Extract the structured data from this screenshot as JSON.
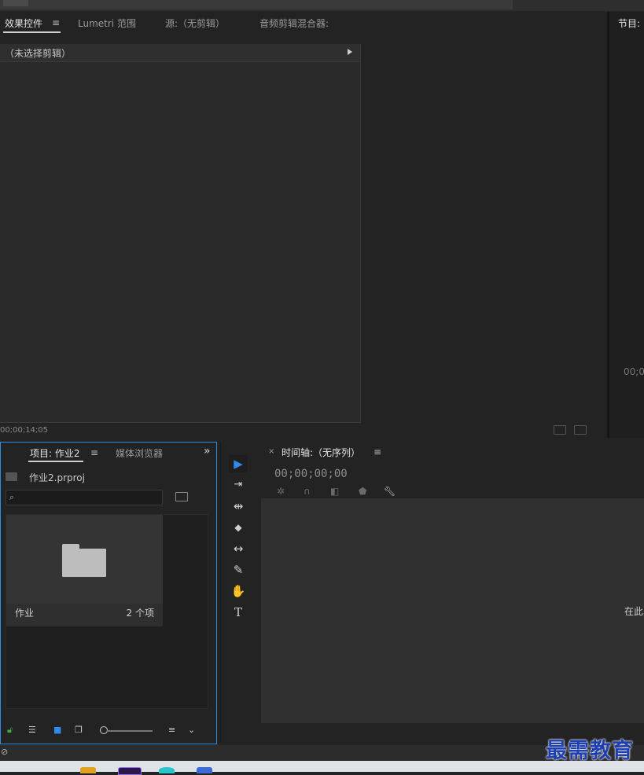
{
  "effect_controls": {
    "tabs": [
      {
        "label": "效果控件",
        "active": true
      },
      {
        "label": "Lumetri 范围",
        "active": false
      },
      {
        "label": "源:（无剪辑）",
        "active": false
      },
      {
        "label": "音频剪辑混合器:",
        "active": false
      }
    ],
    "menu_icon": "hamburger-icon",
    "header_text": "（未选择剪辑）",
    "timecode": "00;00;14;05"
  },
  "program_monitor": {
    "title": "节目:",
    "timecode": "00;0"
  },
  "project": {
    "tabs": [
      {
        "label": "项目: 作业2",
        "active": true
      },
      {
        "label": "媒体浏览器",
        "active": false
      }
    ],
    "overflow_icon": "double-chevron-right-icon",
    "file_name": "作业2.prproj",
    "search": {
      "placeholder": "",
      "value": ""
    },
    "bin": {
      "name": "作业",
      "item_count": "2 个项"
    }
  },
  "tools": [
    {
      "name": "selection-tool",
      "glyph": "▶",
      "active": true
    },
    {
      "name": "track-select-tool",
      "glyph": "⇥",
      "active": false
    },
    {
      "name": "ripple-edit-tool",
      "glyph": "⇹",
      "active": false
    },
    {
      "name": "razor-tool",
      "glyph": "◆",
      "active": false
    },
    {
      "name": "slip-tool",
      "glyph": "↔",
      "active": false
    },
    {
      "name": "pen-tool",
      "glyph": "✎",
      "active": false
    },
    {
      "name": "hand-tool",
      "glyph": "✋",
      "active": false
    },
    {
      "name": "type-tool",
      "glyph": "T",
      "active": false
    }
  ],
  "timeline": {
    "close_glyph": "×",
    "title": "时间轴:（无序列）",
    "timecode": "00;00;00;00",
    "hint": "在此"
  },
  "watermark": "最需教育",
  "colors": {
    "accent": "#2d8ceb",
    "panel_bg": "#232323",
    "watermark": "#1f3fae"
  }
}
